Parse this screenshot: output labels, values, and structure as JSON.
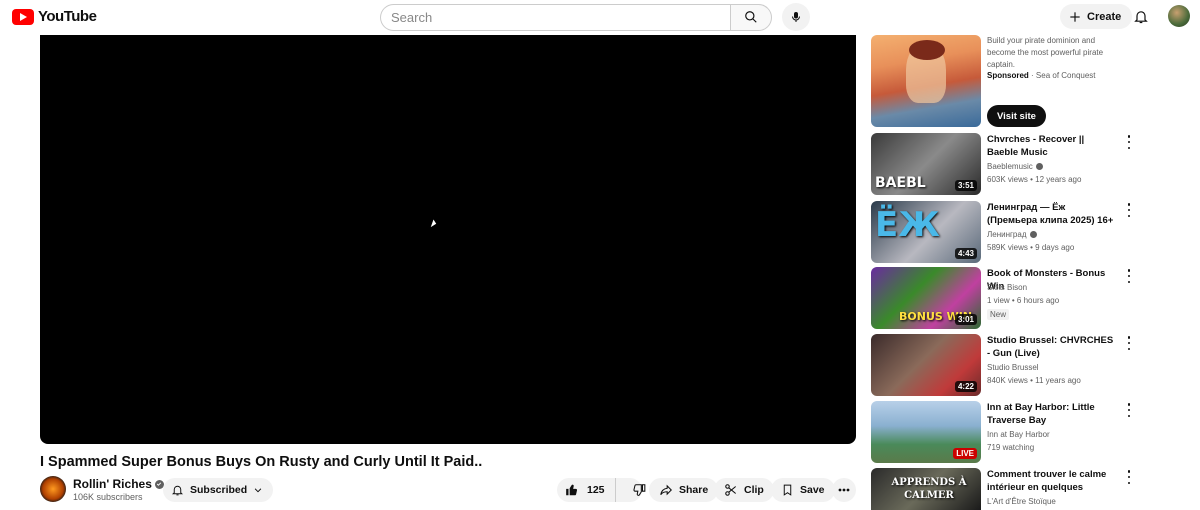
{
  "header": {
    "logo_text": "YouTube",
    "search_placeholder": "Search",
    "create_label": "Create"
  },
  "video": {
    "title": "I Spammed Super Bonus Buys On Rusty and Curly Until It Paid..",
    "channel_name": "Rollin' Riches",
    "subscribers": "106K subscribers",
    "subscribed_label": "Subscribed",
    "like_count": "125",
    "share_label": "Share",
    "clip_label": "Clip",
    "save_label": "Save"
  },
  "ad": {
    "description": "Build your pirate dominion and become the most powerful pirate captain.",
    "sponsored_label": "Sponsored",
    "advertiser": "Sea of Conquest",
    "cta_label": "Visit site"
  },
  "recommendations": [
    {
      "title": "Chvrches - Recover || Baeble Music",
      "channel": "Baeblemusic",
      "verified": true,
      "meta": "603K views • 12 years ago",
      "duration": "3:51",
      "thumb_text": "BAEBL"
    },
    {
      "title": "Ленинград — Ёж (Премьера клипа 2025) 16+",
      "channel": "Ленинград",
      "verified": true,
      "meta": "589K views • 9 days ago",
      "duration": "4:43",
      "thumb_text": "ЁЖ"
    },
    {
      "title": "Book of Monsters - Bonus Win",
      "channel": "Slots Bison",
      "verified": false,
      "meta": "1 view • 6 hours ago",
      "badge": "New",
      "duration": "3:01",
      "thumb_text": "BONUS WIN"
    },
    {
      "title": "Studio Brussel: CHVRCHES - Gun (Live)",
      "channel": "Studio Brussel",
      "verified": false,
      "meta": "840K views • 11 years ago",
      "duration": "4:22"
    },
    {
      "title": "Inn at Bay Harbor: Little Traverse Bay",
      "channel": "Inn at Bay Harbor",
      "verified": false,
      "meta": "719 watching",
      "live_label": "LIVE"
    },
    {
      "title": "Comment trouver le calme intérieur en quelques minutes ...",
      "channel": "L'Art d'Être Stoïque",
      "verified": false,
      "thumb_text": "APPRENDS À CALMER"
    }
  ]
}
